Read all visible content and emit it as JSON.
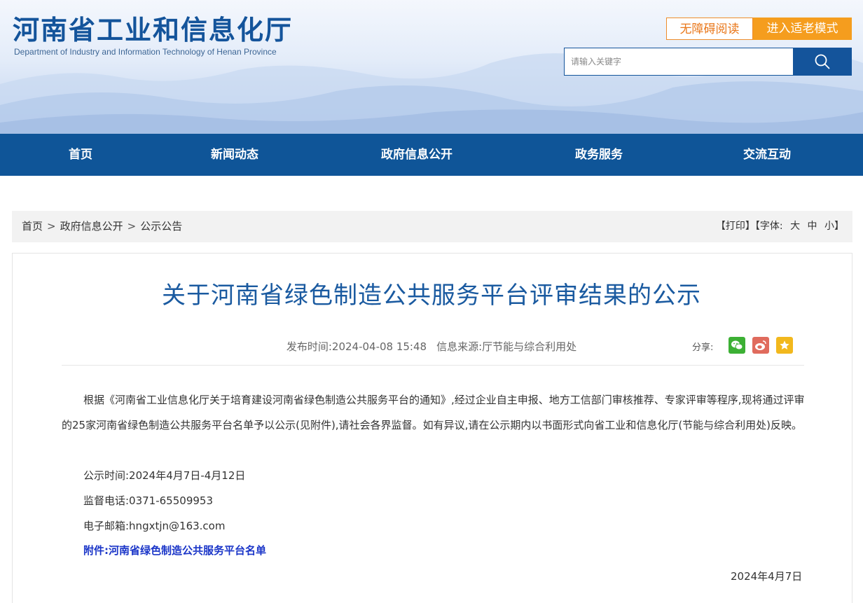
{
  "header": {
    "title": "河南省工业和信息化厅",
    "subtitle": "Department of Industry and Information Technology of Henan Province",
    "accessibility_button": "无障碍阅读",
    "elder_mode_button": "进入适老模式",
    "search_placeholder": "请输入关键字",
    "search_icon": "search-icon"
  },
  "nav": {
    "items": [
      "首页",
      "新闻动态",
      "政府信息公开",
      "政务服务",
      "交流互动"
    ]
  },
  "breadcrumb": {
    "items": [
      "首页",
      "政府信息公开",
      "公示公告"
    ],
    "separator": ">"
  },
  "tools": {
    "print": "【打印】",
    "font_label": "【字体:",
    "font_large": "大",
    "font_medium": "中",
    "font_small": "小",
    "font_close": "】"
  },
  "article": {
    "title": "关于河南省绿色制造公共服务平台评审结果的公示",
    "publish_label": "发布时间:",
    "publish_time": "2024-04-08 15:48",
    "source_label": "信息来源:",
    "source": "厅节能与综合利用处",
    "share_label": "分享:",
    "share_icons": [
      "wechat-icon",
      "weibo-icon",
      "favorite-star-icon"
    ],
    "body": "根据《河南省工业信息化厅关于培育建设河南省绿色制造公共服务平台的通知》,经过企业自主申报、地方工信部门审核推荐、专家评审等程序,现将通过评审的25家河南省绿色制造公共服务平台名单予以公示(见附件),请社会各界监督。如有异议,请在公示期内以书面形式向省工业和信息化厅(节能与综合利用处)反映。",
    "period": "公示时间:2024年4月7日-4月12日",
    "phone": "监督电话:0371-65509953",
    "email": "电子邮箱:hngxtjn@163.com",
    "attachment": "附件:河南省绿色制造公共服务平台名单",
    "date": "2024年4月7日"
  },
  "colors": {
    "brand_blue": "#0f5598",
    "title_blue": "#1a5aa0",
    "accent_orange": "#f59d1e",
    "link_blue": "#1a35c8"
  }
}
